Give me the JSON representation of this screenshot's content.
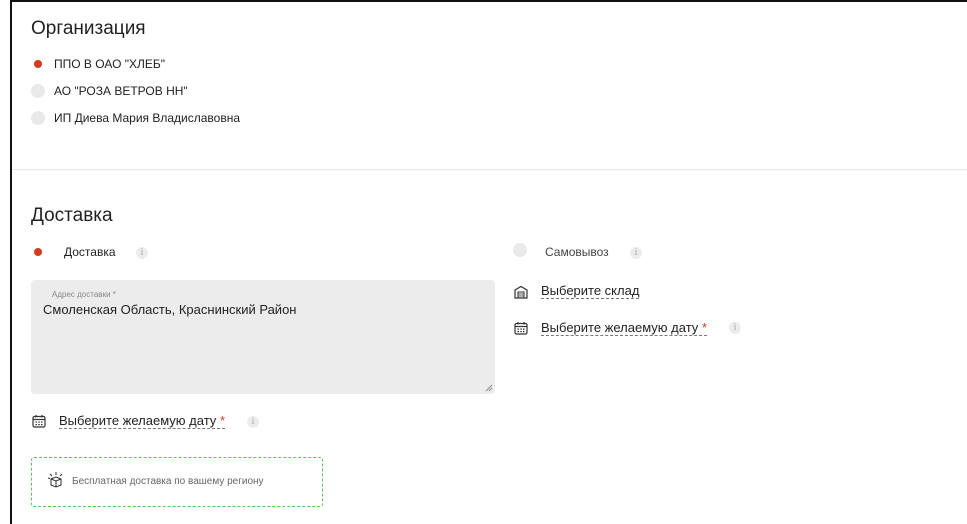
{
  "organization": {
    "title": "Организация",
    "options": [
      {
        "label": "ППО В ОАО \"ХЛЕБ\"",
        "selected": true
      },
      {
        "label": "АО \"РОЗА ВЕТРОВ НН\"",
        "selected": false
      },
      {
        "label": "ИП Диева Мария Владиславовна",
        "selected": false
      }
    ]
  },
  "delivery": {
    "title": "Доставка",
    "option_delivery": "Доставка",
    "option_pickup": "Самовывоз",
    "address_label": "Адрес доставки *",
    "address_value": "Смоленская Область, Краснинский Район",
    "date_link": "Выберите желаемую дату",
    "required_mark": "*",
    "warehouse_link": "Выберите склад",
    "pickup_date_link": "Выберите желаемую дату",
    "free_shipping": "Бесплатная доставка по вашему региону"
  },
  "colors": {
    "accent": "#d43a1c",
    "promo_border": "#5cc25c"
  }
}
